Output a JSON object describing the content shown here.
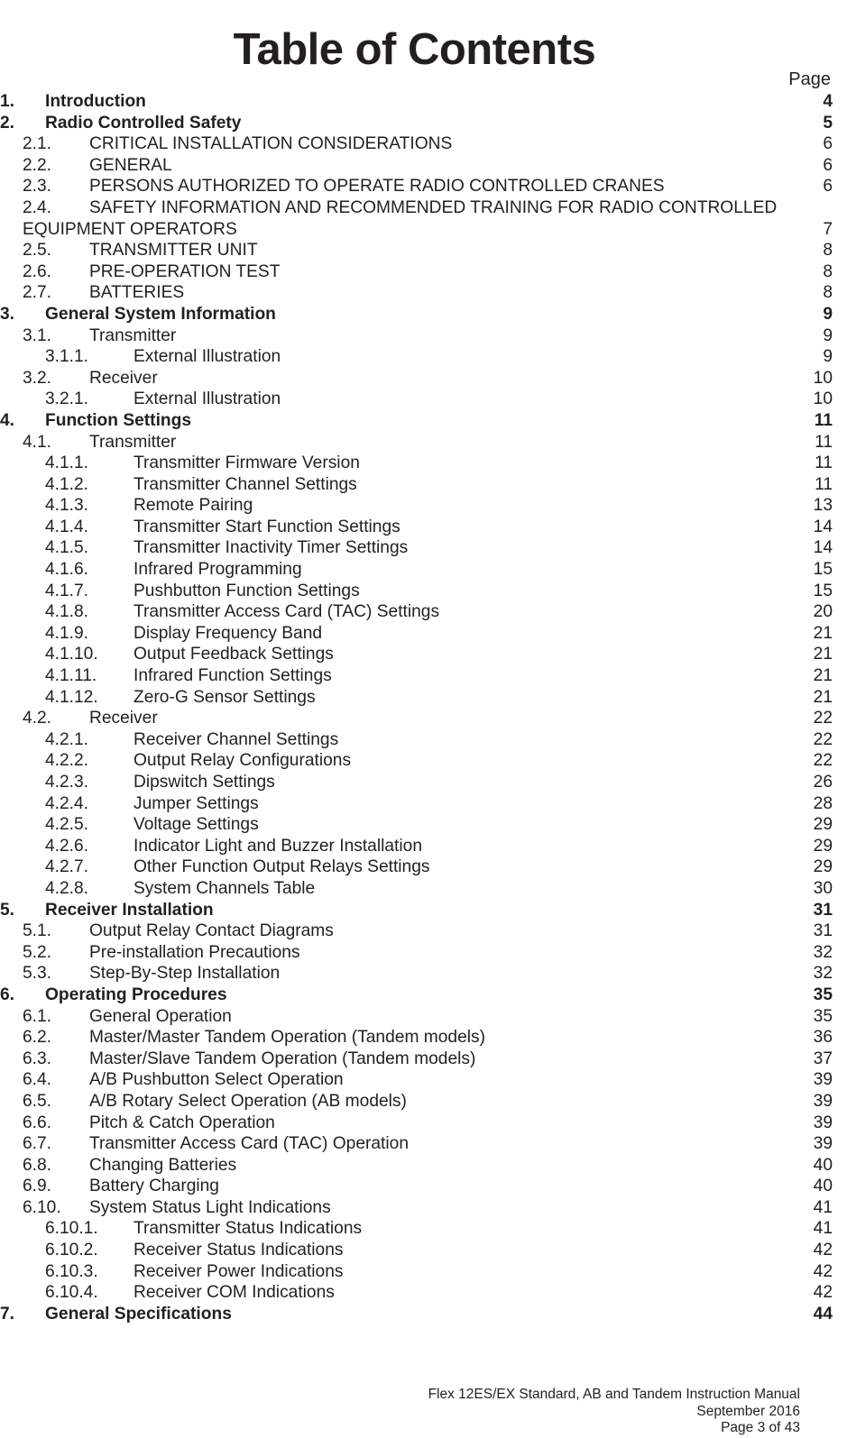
{
  "document": {
    "title": "Table of Contents",
    "page_column_header": "Page"
  },
  "toc": [
    {
      "level": 1,
      "number": "1.",
      "label": "Introduction",
      "page": "4"
    },
    {
      "level": 1,
      "number": "2.",
      "label": "Radio Controlled Safety",
      "page": "5"
    },
    {
      "level": 2,
      "number": "2.1.",
      "label": "CRITICAL INSTALLATION CONSIDERATIONS",
      "page": "6"
    },
    {
      "level": 2,
      "number": "2.2.",
      "label": "GENERAL",
      "page": "6"
    },
    {
      "level": 2,
      "number": "2.3.",
      "label": "PERSONS AUTHORIZED TO OPERATE RADIO CONTROLLED CRANES",
      "page": "6"
    },
    {
      "level": 2,
      "number": "2.4.",
      "label": "SAFETY INFORMATION AND RECOMMENDED TRAINING FOR RADIO CONTROLLED",
      "continuation": "EQUIPMENT OPERATORS",
      "page": "7"
    },
    {
      "level": 2,
      "number": "2.5.",
      "label": "TRANSMITTER UNIT",
      "page": "8"
    },
    {
      "level": 2,
      "number": "2.6.",
      "label": "PRE-OPERATION TEST",
      "page": "8"
    },
    {
      "level": 2,
      "number": "2.7.",
      "label": "BATTERIES",
      "page": "8"
    },
    {
      "level": 1,
      "number": "3.",
      "label": "General System Information",
      "page": "9"
    },
    {
      "level": 2,
      "number": "3.1.",
      "label": "Transmitter",
      "page": "9"
    },
    {
      "level": 3,
      "number": "3.1.1.",
      "label": "External Illustration",
      "page": "9"
    },
    {
      "level": 2,
      "number": "3.2.",
      "label": "Receiver",
      "page": "10"
    },
    {
      "level": 3,
      "number": "3.2.1.",
      "label": "External Illustration",
      "page": "10"
    },
    {
      "level": 1,
      "number": "4.",
      "label": "Function Settings",
      "page": "11"
    },
    {
      "level": 2,
      "number": "4.1.",
      "label": "Transmitter",
      "page": "11"
    },
    {
      "level": 3,
      "number": "4.1.1.",
      "label": "Transmitter Firmware Version",
      "page": "11"
    },
    {
      "level": 3,
      "number": "4.1.2.",
      "label": "Transmitter Channel Settings",
      "page": "11"
    },
    {
      "level": 3,
      "number": "4.1.3.",
      "label": "Remote Pairing",
      "page": "13"
    },
    {
      "level": 3,
      "number": "4.1.4.",
      "label": "Transmitter Start Function Settings",
      "page": "14"
    },
    {
      "level": 3,
      "number": "4.1.5.",
      "label": "Transmitter Inactivity Timer Settings",
      "page": "14"
    },
    {
      "level": 3,
      "number": "4.1.6.",
      "label": "Infrared Programming",
      "page": "15"
    },
    {
      "level": 3,
      "number": "4.1.7.",
      "label": "Pushbutton Function Settings",
      "page": "15"
    },
    {
      "level": 3,
      "number": "4.1.8.",
      "label": "Transmitter Access Card (TAC) Settings",
      "page": "20"
    },
    {
      "level": 3,
      "number": "4.1.9.",
      "label": "Display Frequency Band",
      "page": "21"
    },
    {
      "level": 3,
      "number": "4.1.10.",
      "label": "Output Feedback Settings",
      "page": "21"
    },
    {
      "level": 3,
      "number": "4.1.11.",
      "label": "Infrared Function Settings",
      "page": "21"
    },
    {
      "level": 3,
      "number": "4.1.12.",
      "label": "Zero-G Sensor Settings",
      "page": "21"
    },
    {
      "level": 2,
      "number": "4.2.",
      "label": "Receiver",
      "page": "22"
    },
    {
      "level": 3,
      "number": "4.2.1.",
      "label": "Receiver Channel Settings",
      "page": "22"
    },
    {
      "level": 3,
      "number": "4.2.2.",
      "label": "Output Relay Configurations",
      "page": "22"
    },
    {
      "level": 3,
      "number": "4.2.3.",
      "label": "Dipswitch Settings",
      "page": "26"
    },
    {
      "level": 3,
      "number": "4.2.4.",
      "label": "Jumper Settings",
      "page": "28"
    },
    {
      "level": 3,
      "number": "4.2.5.",
      "label": "Voltage Settings",
      "page": "29"
    },
    {
      "level": 3,
      "number": "4.2.6.",
      "label": "Indicator Light and Buzzer Installation",
      "page": "29"
    },
    {
      "level": 3,
      "number": "4.2.7.",
      "label": "Other Function Output Relays Settings",
      "page": "29"
    },
    {
      "level": 3,
      "number": "4.2.8.",
      "label": "System Channels Table",
      "page": "30"
    },
    {
      "level": 1,
      "number": "5.",
      "label": "Receiver Installation",
      "page": "31"
    },
    {
      "level": 2,
      "number": "5.1.",
      "label": "Output Relay Contact Diagrams",
      "page": "31"
    },
    {
      "level": 2,
      "number": "5.2.",
      "label": "Pre-installation Precautions",
      "page": "32"
    },
    {
      "level": 2,
      "number": "5.3.",
      "label": "Step-By-Step Installation",
      "page": "32"
    },
    {
      "level": 1,
      "number": "6.",
      "label": "Operating Procedures",
      "page": "35"
    },
    {
      "level": 2,
      "number": "6.1.",
      "label": "General Operation",
      "page": "35"
    },
    {
      "level": 2,
      "number": "6.2.",
      "label": "Master/Master Tandem Operation (Tandem models)",
      "page": "36"
    },
    {
      "level": 2,
      "number": "6.3.",
      "label": "Master/Slave Tandem Operation (Tandem models)",
      "page": "37"
    },
    {
      "level": 2,
      "number": "6.4.",
      "label": "A/B Pushbutton Select Operation",
      "page": "39"
    },
    {
      "level": 2,
      "number": "6.5.",
      "label": "A/B Rotary Select Operation (AB models)",
      "page": "39"
    },
    {
      "level": 2,
      "number": "6.6.",
      "label": "Pitch & Catch Operation",
      "page": "39"
    },
    {
      "level": 2,
      "number": "6.7.",
      "label": "Transmitter Access Card (TAC) Operation",
      "page": "39"
    },
    {
      "level": 2,
      "number": "6.8.",
      "label": "Changing Batteries",
      "page": "40"
    },
    {
      "level": 2,
      "number": "6.9.",
      "label": "Battery Charging",
      "page": "40"
    },
    {
      "level": 2,
      "number": "6.10.",
      "label": "System Status Light Indications",
      "page": "41"
    },
    {
      "level": 3,
      "number": "6.10.1.",
      "label": "Transmitter Status Indications",
      "page": "41"
    },
    {
      "level": 3,
      "number": "6.10.2.",
      "label": "Receiver Status Indications",
      "page": "42"
    },
    {
      "level": 3,
      "number": "6.10.3.",
      "label": "Receiver Power Indications",
      "page": "42"
    },
    {
      "level": 3,
      "number": "6.10.4.",
      "label": "Receiver COM Indications",
      "page": "42"
    },
    {
      "level": 1,
      "number": "7.",
      "label": "General Specifications",
      "page": "44"
    }
  ],
  "footer": {
    "manual_title": "Flex 12ES/EX Standard, AB and Tandem Instruction Manual",
    "date": "September 2016",
    "page_info": "Page 3 of 43"
  }
}
